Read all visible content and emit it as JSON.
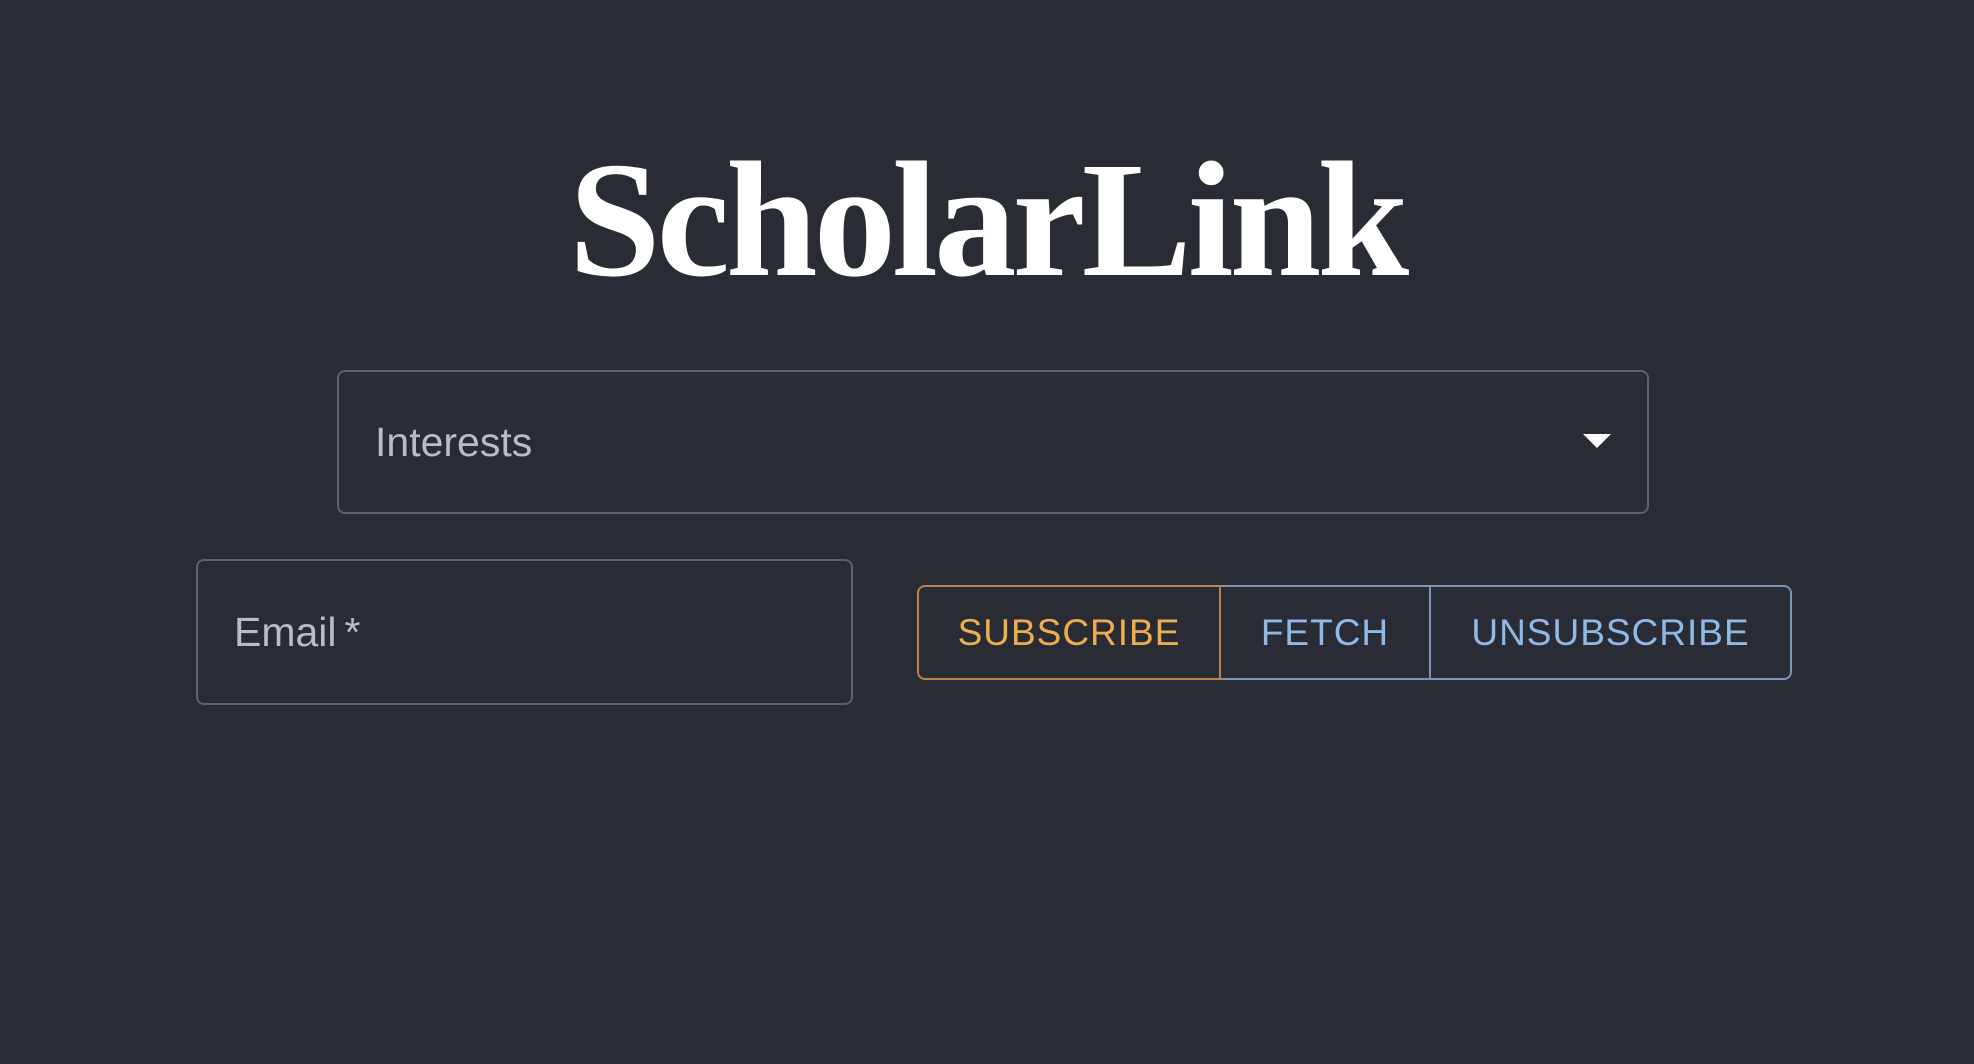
{
  "app": {
    "title": "ScholarLink"
  },
  "interests_select": {
    "label": "Interests",
    "icon": "caret-down-icon"
  },
  "email_field": {
    "label": "Email",
    "required_marker": "*",
    "value": ""
  },
  "actions": {
    "subscribe_label": "SUBSCRIBE",
    "fetch_label": "FETCH",
    "unsubscribe_label": "UNSUBSCRIBE"
  },
  "colors": {
    "background": "#292c35",
    "subscribe_accent": "#f0ad4e",
    "secondary_accent": "#90b9e8"
  }
}
